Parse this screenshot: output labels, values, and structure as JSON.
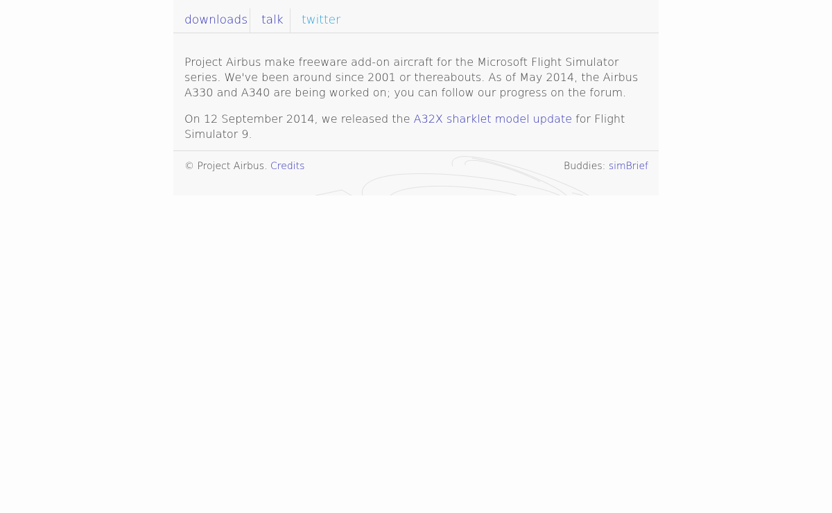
{
  "nav": {
    "items": [
      {
        "label": "downloads"
      },
      {
        "label": "talk"
      },
      {
        "label": "twitter"
      }
    ]
  },
  "content": {
    "para1": "Project Airbus make freeware add-on aircraft for the Microsoft Flight Simulator series. We've been around since 2001 or thereabouts. As of May 2014, the Airbus A330 and A340 are being worked on; you can follow our progress on the forum.",
    "para2_before": "On 12 September 2014, we released the ",
    "para2_link": "A32X sharklet model update",
    "para2_after": " for Flight Simulator 9."
  },
  "footer": {
    "copyright": "© Project Airbus. ",
    "credits_link": "Credits",
    "buddies_label": "Buddies: ",
    "buddies_link": "simBrief"
  },
  "colors": {
    "link": "#2b2bb4",
    "twitter": "#2ea0d8",
    "panel_background": "#f8f8f8",
    "page_background": "#fdfdfd"
  }
}
